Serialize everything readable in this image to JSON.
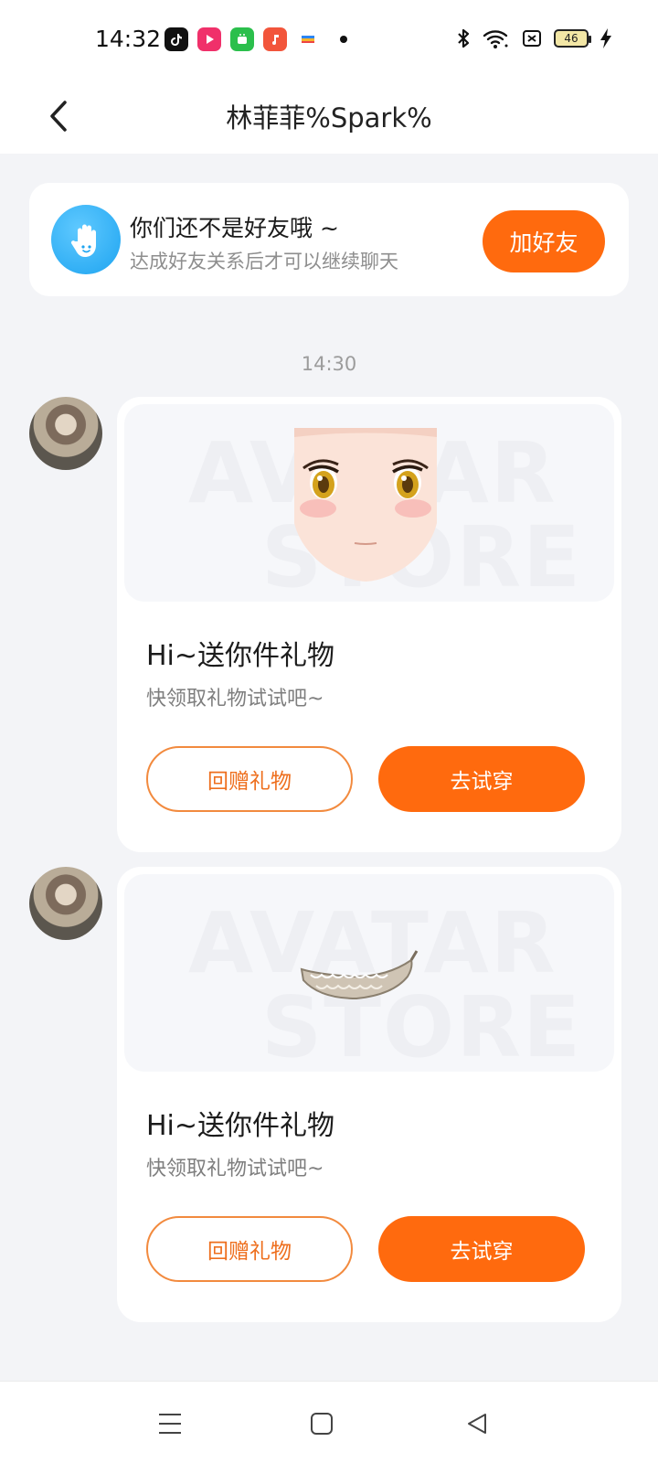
{
  "status_bar": {
    "time": "14:32",
    "battery": "46",
    "icons": [
      "tiktok-icon",
      "video-app-icon",
      "app-store-icon",
      "music-icon",
      "wallet-icon",
      "bluetooth-icon",
      "wifi-icon",
      "sim-off-icon",
      "charging-icon"
    ]
  },
  "header": {
    "title": "林菲菲%Spark%"
  },
  "friend_notice": {
    "title": "你们还不是好友哦 ~",
    "subtitle": "达成好友关系后才可以继续聊天",
    "add_friend_label": "加好友"
  },
  "chat": {
    "timestamp": "14:30",
    "messages": [
      {
        "gift_image": "anime-face-gift",
        "watermark_line1": "AVATAR",
        "watermark_line2": "STORE",
        "title": "Hi~送你件礼物",
        "subtitle": "快领取礼物试试吧~",
        "return_gift_label": "回赠礼物",
        "try_on_label": "去试穿"
      },
      {
        "gift_image": "teeth-accessory-gift",
        "watermark_line1": "AVATAR",
        "watermark_line2": "STORE",
        "title": "Hi~送你件礼物",
        "subtitle": "快领取礼物试试吧~",
        "return_gift_label": "回赠礼物",
        "try_on_label": "去试穿"
      }
    ]
  },
  "colors": {
    "accent": "#ff6a0e",
    "background": "#f3f4f7",
    "card": "#ffffff"
  }
}
